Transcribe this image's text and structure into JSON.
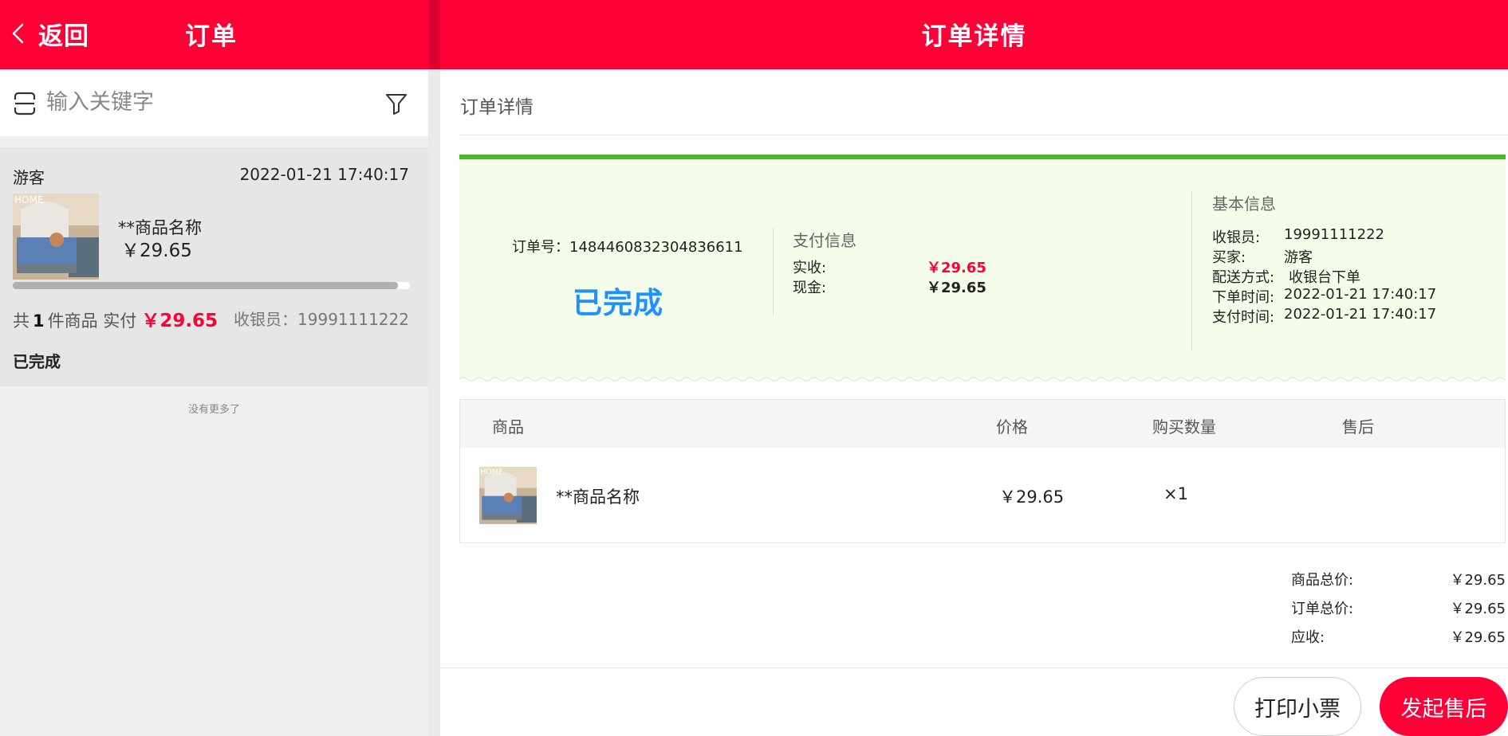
{
  "left": {
    "back_label": "返回",
    "title": "订单",
    "search_placeholder": "输入关键字",
    "order": {
      "buyer": "游客",
      "time": "2022-01-21 17:40:17",
      "product_name": "**商品名称",
      "product_price": "￥29.65",
      "summary_prefix": "共",
      "item_count": "1",
      "summary_mid": "件商品 实付",
      "paid": "￥29.65",
      "cashier": "收银员：19991111222",
      "status": "已完成",
      "scroll_position": 0.97
    },
    "no_more": "没有更多了"
  },
  "right": {
    "title": "订单详情",
    "section_label": "订单详情",
    "order_no_label": "订单号：",
    "order_no": "1484460832304836611",
    "status": "已完成",
    "pay_info": {
      "title": "支付信息",
      "rows": [
        {
          "label": "实收:",
          "value": "￥29.65"
        },
        {
          "label": "现金:",
          "value": "￥29.65"
        }
      ]
    },
    "basic_info": {
      "title": "基本信息",
      "rows": [
        {
          "label": "收银员:",
          "value": "19991111222"
        },
        {
          "label": "买家:",
          "value": "游客"
        },
        {
          "label": "配送方式:",
          "value": "收银台下单"
        },
        {
          "label": "下单时间:",
          "value": "2022-01-21 17:40:17"
        },
        {
          "label": "支付时间:",
          "value": "2022-01-21 17:40:17"
        }
      ]
    },
    "table": {
      "headers": [
        "商品",
        "价格",
        "购买数量",
        "售后"
      ],
      "rows": [
        {
          "name": "**商品名称",
          "price": "￥29.65",
          "qty": "×1",
          "after_sale": ""
        }
      ]
    },
    "totals": [
      {
        "label": "商品总价:",
        "value": "￥29.65"
      },
      {
        "label": "订单总价:",
        "value": "￥29.65"
      },
      {
        "label": "应收:",
        "value": "￥29.65"
      }
    ],
    "buttons": {
      "print": "打印小票",
      "after_sale": "发起售后"
    }
  },
  "colors": {
    "brand_red": "#ff0036",
    "status_blue": "#1e90ff",
    "success_green": "#4bb82b",
    "status_bg": "#f4fdea"
  }
}
